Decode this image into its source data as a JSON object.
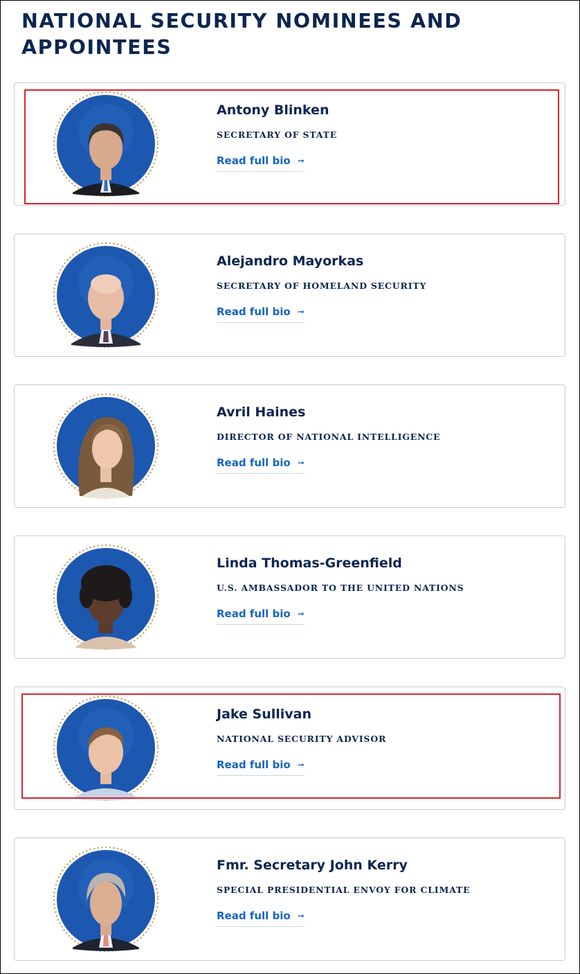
{
  "page": {
    "title": "NATIONAL SECURITY NOMINEES AND APPOINTEES"
  },
  "colors": {
    "navy": "#0c2650",
    "link_blue": "#1565c0",
    "highlight_red": "#d6262b",
    "portrait_blue": "#1c57b0",
    "seal_gold": "#c9a66b"
  },
  "people": [
    {
      "name": "Antony Blinken",
      "role": "SECRETARY OF STATE",
      "link": "Read full bio",
      "arrow_icon": "arrow-right-icon",
      "highlighted": true
    },
    {
      "name": "Alejandro Mayorkas",
      "role": "SECRETARY OF HOMELAND SECURITY",
      "link": "Read full bio",
      "arrow_icon": "arrow-right-icon",
      "highlighted": false
    },
    {
      "name": "Avril Haines",
      "role": "DIRECTOR OF NATIONAL INTELLIGENCE",
      "link": "Read full bio",
      "arrow_icon": "arrow-right-icon",
      "highlighted": false
    },
    {
      "name": "Linda Thomas-Greenfield",
      "role": "U.S. AMBASSADOR TO THE UNITED NATIONS",
      "link": "Read full bio",
      "arrow_icon": "arrow-right-icon",
      "highlighted": false
    },
    {
      "name": "Jake Sullivan",
      "role": "NATIONAL SECURITY ADVISOR",
      "link": "Read full bio",
      "arrow_icon": "arrow-right-icon",
      "highlighted": true
    },
    {
      "name": "Fmr. Secretary John Kerry",
      "role": "SPECIAL PRESIDENTIAL ENVOY FOR CLIMATE",
      "link": "Read full bio",
      "arrow_icon": "arrow-right-icon",
      "highlighted": false
    }
  ]
}
